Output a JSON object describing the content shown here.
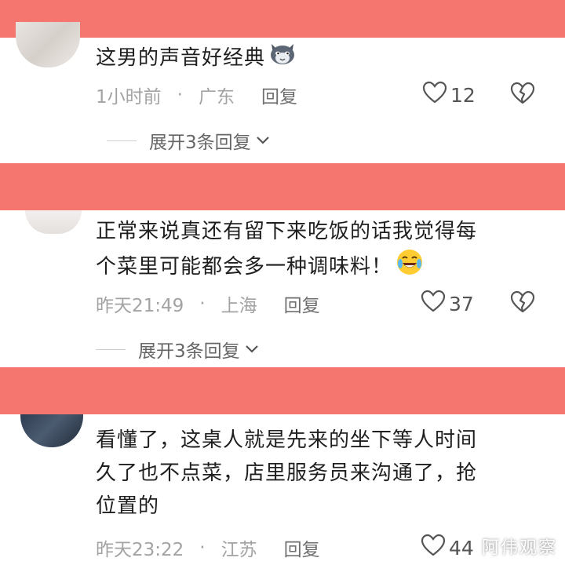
{
  "comments": [
    {
      "text_lines": [
        "这男的声音好经典"
      ],
      "emoji": "cat-emoji",
      "time": "1小时前",
      "dot": "·",
      "location": "广东",
      "reply_label": "回复",
      "likes": "12",
      "expand_label": "展开3条回复"
    },
    {
      "text_lines": [
        "正常来说真还有留下来吃饭的话我觉得每",
        "个菜里可能都会多一种调味料！"
      ],
      "emoji": "crying-laughing-emoji",
      "time": "昨天21:49",
      "dot": "·",
      "location": "上海",
      "reply_label": "回复",
      "likes": "37",
      "expand_label": "展开3条回复"
    },
    {
      "text_lines": [
        "看懂了，这桌人就是先来的坐下等人时间",
        "久了也不点菜，店里服务员来沟通了，抢",
        "位置的"
      ],
      "time": "昨天23:22",
      "dot": "·",
      "location": "江苏",
      "reply_label": "回复",
      "likes": "44"
    }
  ],
  "watermark": "阿伟观察",
  "colors": {
    "band": "#f4766e",
    "meta_text": "#a3a3a3",
    "comment_text": "#1f1f1f"
  },
  "icons": {
    "like": "heart-outline-icon",
    "dislike": "broken-heart-icon",
    "expand": "chevron-down-icon"
  }
}
